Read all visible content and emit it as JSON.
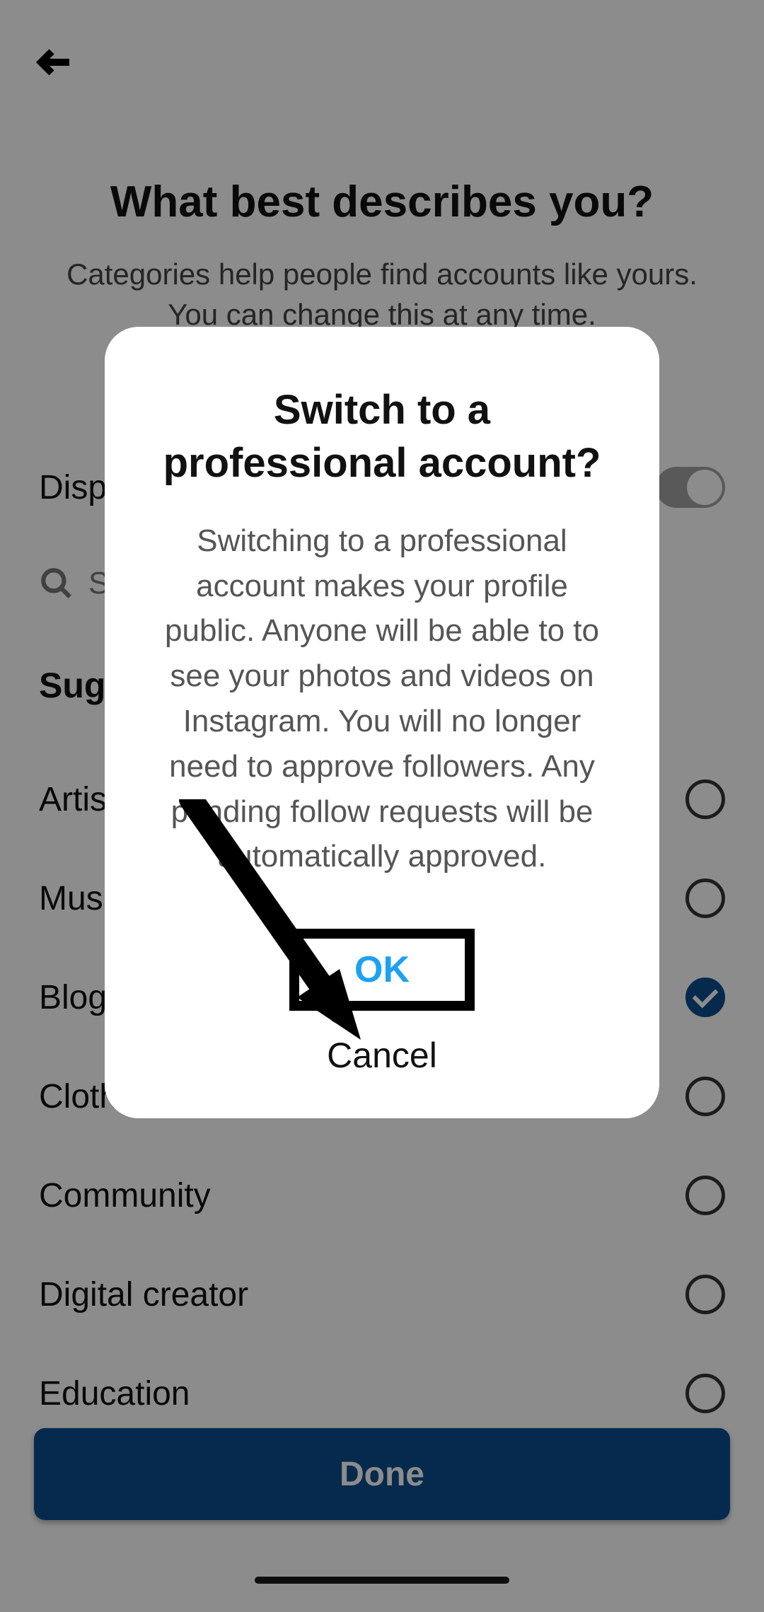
{
  "header": {
    "title": "What best describes you?",
    "subtitle": "Categories help people find accounts like yours. You can change this at any time."
  },
  "display_row": {
    "label": "Display on profile"
  },
  "search": {
    "placeholder": "Search categories"
  },
  "suggested_label": "Suggested",
  "categories": [
    {
      "label": "Artist",
      "selected": false
    },
    {
      "label": "Musician/band",
      "selected": false
    },
    {
      "label": "Blogger",
      "selected": true
    },
    {
      "label": "Clothing (Brand)",
      "selected": false
    },
    {
      "label": "Community",
      "selected": false
    },
    {
      "label": "Digital creator",
      "selected": false
    },
    {
      "label": "Education",
      "selected": false
    }
  ],
  "done_label": "Done",
  "dialog": {
    "title": "Switch to a professional account?",
    "body": "Switching to a professional account makes your profile public. Anyone will be able to to see your photos and videos on Instagram. You will no longer need to approve followers. Any pending follow requests will be automatically approved.",
    "ok": "OK",
    "cancel": "Cancel"
  },
  "colors": {
    "accent": "#1da1f2",
    "primary_button": "#0a4d8c"
  }
}
